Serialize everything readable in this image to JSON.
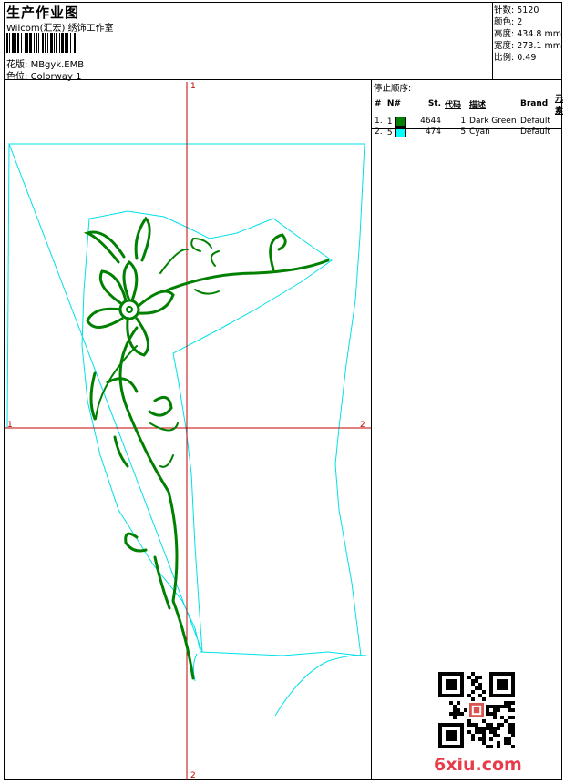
{
  "header": {
    "title": "生产作业图",
    "subtitle": "Wilcom(汇宏) 绣饰工作室",
    "design_label": "花版:",
    "design_value": "MBgyk.EMB",
    "colorway_label": "色位:",
    "colorway_value": "Colorway 1"
  },
  "stats": [
    {
      "label": "针数:",
      "value": "5120"
    },
    {
      "label": "颜色:",
      "value": "2"
    },
    {
      "label": "高度:",
      "value": "434.8 mm"
    },
    {
      "label": "宽度:",
      "value": "273.1 mm"
    },
    {
      "label": "比例:",
      "value": "0.49"
    }
  ],
  "stop_sequence": {
    "title": "停止顺序:",
    "columns": [
      "#",
      "N#",
      "St.",
      "代码",
      "描述",
      "Brand",
      "元素"
    ],
    "rows": [
      {
        "index": "1.",
        "needle": "1",
        "color": "#008000",
        "stitches": "4644",
        "code": "1",
        "description": "Dark Green",
        "brand": "Default"
      },
      {
        "index": "2.",
        "needle": "5",
        "color": "#00FFFF",
        "stitches": "474",
        "code": "5",
        "description": "Cyan",
        "brand": "Default"
      }
    ]
  },
  "axes": {
    "top": "1",
    "bottom": "2",
    "left": "1",
    "right": "2"
  },
  "colors": {
    "outline": "#00e0e8",
    "embroidery": "#008000",
    "axis": "#c00000"
  },
  "watermark": "6xiu.com"
}
